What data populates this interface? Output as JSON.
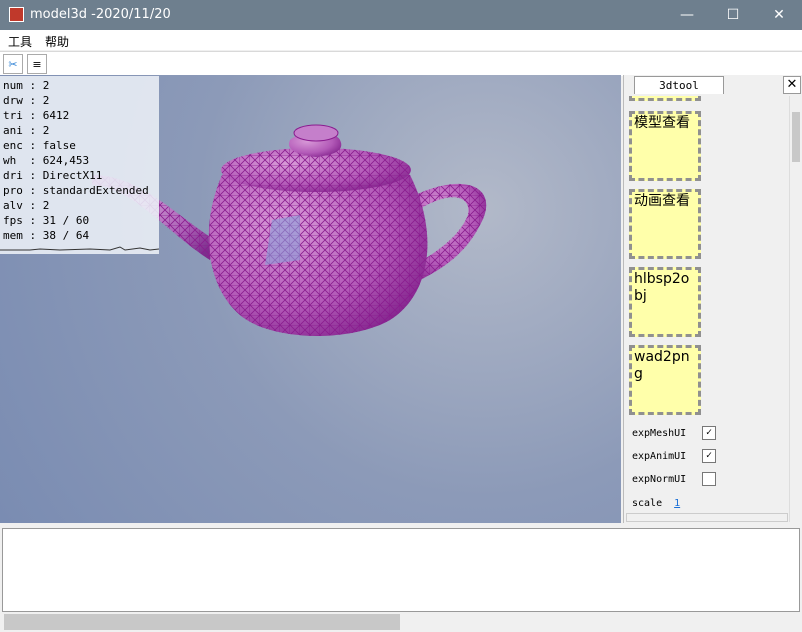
{
  "window": {
    "title": "model3d -2020/11/20",
    "controls": {
      "minimize": "—",
      "maximize": "☐",
      "close": "✕"
    }
  },
  "menu": {
    "items": [
      "工具",
      "帮助"
    ]
  },
  "toolbar": {
    "buttons": [
      {
        "name": "tool-cut",
        "icon": "✂"
      },
      {
        "name": "tool-list",
        "icon": "≡"
      }
    ]
  },
  "stats": [
    "num : 2",
    "drw : 2",
    "tri : 6412",
    "ani : 2",
    "enc : false",
    "wh  : 624,453",
    "dri : DirectX11",
    "pro : standardExtended",
    "alv : 2",
    "fps : 31 / 60",
    "mem : 38 / 64"
  ],
  "panel": {
    "tab": "3dtool",
    "close": "✕",
    "cards": [
      "模型查看",
      "动画查看",
      "hlbsp2obj",
      "wad2png"
    ],
    "options": [
      {
        "label": "expMeshUI",
        "checked": true
      },
      {
        "label": "expAnimUI",
        "checked": true
      },
      {
        "label": "expNormUI",
        "checked": false
      }
    ],
    "scale_label": "scale",
    "scale_value": "1"
  },
  "colors": {
    "titlebar": "#6e7f8e",
    "card_bg": "#ffffaa",
    "mesh": "#8a1c8f"
  }
}
